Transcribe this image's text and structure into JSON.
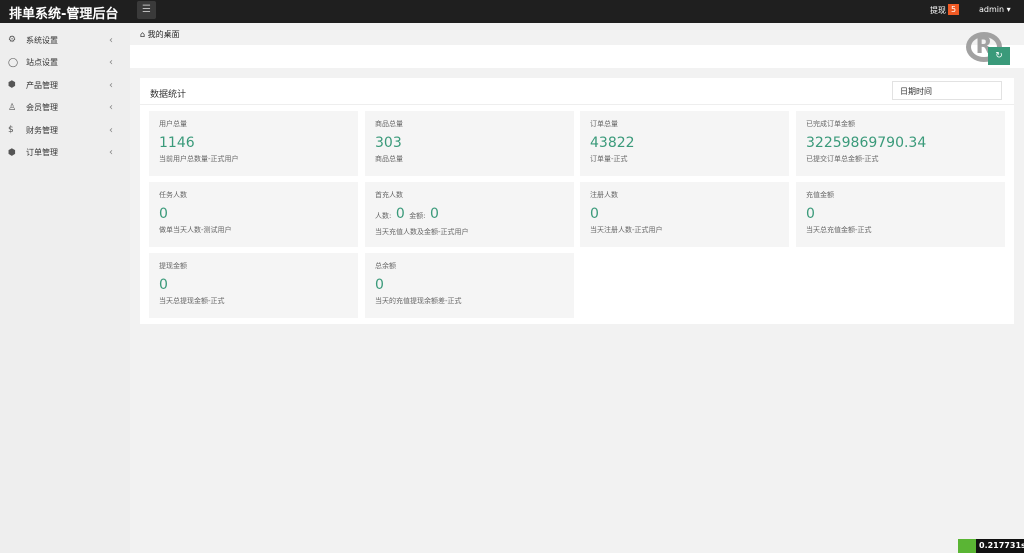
{
  "app_title": "排单系统-管理后台",
  "topbar": {
    "withdraw_label": "提现",
    "withdraw_count": "5",
    "user": "admin"
  },
  "sidebar": {
    "items": [
      {
        "label": "系统设置"
      },
      {
        "label": "站点设置"
      },
      {
        "label": "产品管理"
      },
      {
        "label": "会员管理"
      },
      {
        "label": "财务管理"
      },
      {
        "label": "订单管理"
      }
    ]
  },
  "breadcrumb": "我的桌面",
  "card": {
    "title": "数据统计",
    "date_placeholder": "日期时间"
  },
  "stats": [
    {
      "title": "用户总量",
      "value": "1146",
      "desc": "当前用户总数量-正式用户"
    },
    {
      "title": "商品总量",
      "value": "303",
      "desc": "商品总量"
    },
    {
      "title": "订单总量",
      "value": "43822",
      "desc": "订单量-正式"
    },
    {
      "title": "已完成订单金额",
      "value": "32259869790.34",
      "desc": "已提交订单总金额-正式"
    },
    {
      "title": "任务人数",
      "value": "0",
      "desc": "做单当天人数-测试用户"
    },
    {
      "title": "首充人数",
      "count_label": "人数:",
      "count": "0",
      "amount_label": "金额:",
      "amount": "0",
      "desc": "当天充值人数及金额-正式用户"
    },
    {
      "title": "注册人数",
      "value": "0",
      "desc": "当天注册人数-正式用户"
    },
    {
      "title": "充值金额",
      "value": "0",
      "desc": "当天总充值金额-正式"
    },
    {
      "title": "提现金额",
      "value": "0",
      "desc": "当天总提现金额-正式"
    },
    {
      "title": "总余额",
      "value": "0",
      "desc": "当天的充值提现余额差-正式"
    }
  ],
  "timer": "0.217731s"
}
